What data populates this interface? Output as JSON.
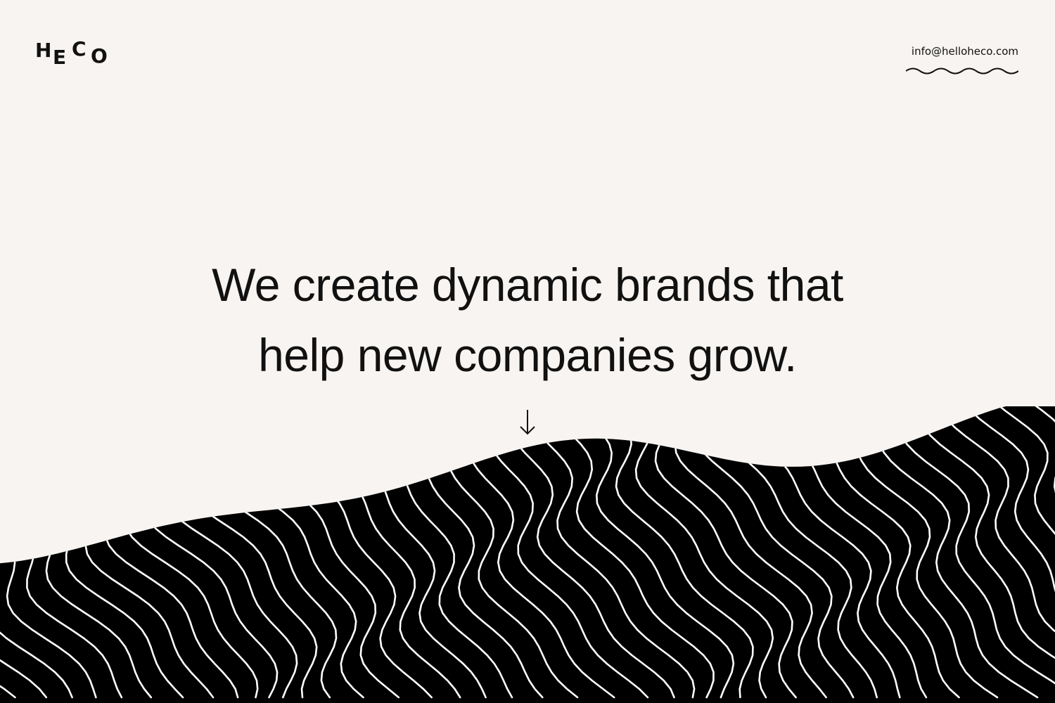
{
  "brand": {
    "letters": [
      "H",
      "E",
      "C",
      "O"
    ]
  },
  "header": {
    "email": "info@helloheco.com"
  },
  "hero": {
    "line1": "We create dynamic brands that",
    "line2": "help new companies grow."
  },
  "icons": {
    "scroll": "arrow-down-icon",
    "email_decoration": "squiggle-underline"
  },
  "colors": {
    "background": "#f7f4f1",
    "text": "#111111",
    "terrain": "#000000",
    "stripes": "#ffffff"
  }
}
